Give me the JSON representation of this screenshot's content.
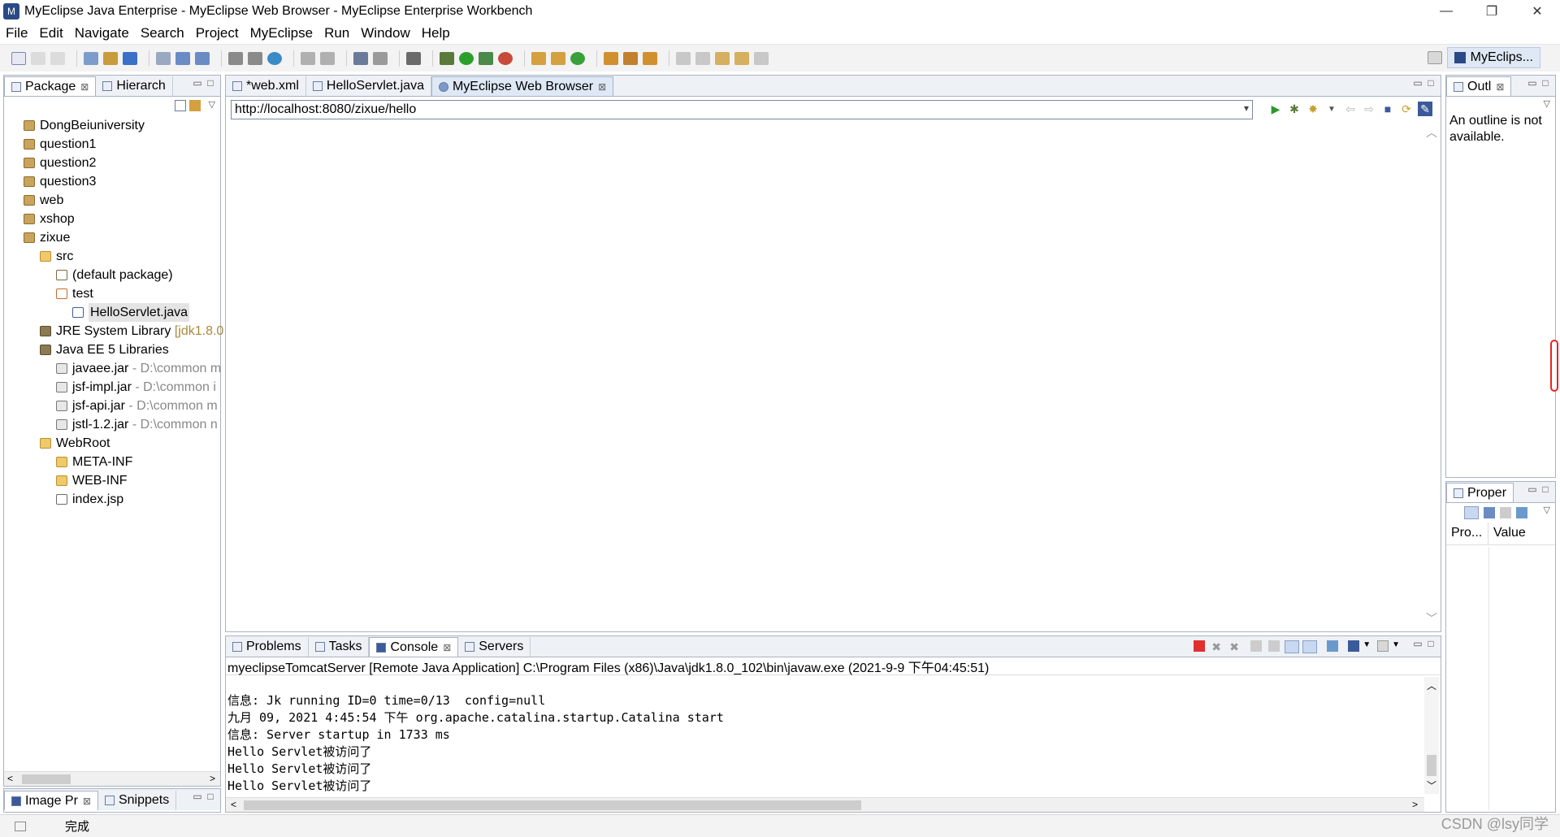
{
  "window": {
    "title": "MyEclipse Java Enterprise - MyEclipse Web Browser - MyEclipse Enterprise Workbench",
    "minimize": "—",
    "maximize": "❐",
    "close": "✕"
  },
  "menu": [
    "File",
    "Edit",
    "Navigate",
    "Search",
    "Project",
    "MyEclipse",
    "Run",
    "Window",
    "Help"
  ],
  "perspective": {
    "label": "MyEclips..."
  },
  "package_view": {
    "tabs": [
      {
        "label": "Package",
        "close": "⊠"
      },
      {
        "label": "Hierarch"
      }
    ],
    "tree": [
      {
        "label": "DongBeiuniversity"
      },
      {
        "label": "question1"
      },
      {
        "label": "question2"
      },
      {
        "label": "question3"
      },
      {
        "label": "web"
      },
      {
        "label": "xshop"
      },
      {
        "label": "zixue"
      },
      {
        "label": "src"
      },
      {
        "label": "(default package)"
      },
      {
        "label": "test"
      },
      {
        "label": "HelloServlet.java"
      },
      {
        "label": "JRE System Library",
        "suffix": "[jdk1.8.0"
      },
      {
        "label": "Java EE 5 Libraries"
      },
      {
        "label": "javaee.jar",
        "suffix": "- D:\\common m"
      },
      {
        "label": "jsf-impl.jar",
        "suffix": "- D:\\common i"
      },
      {
        "label": "jsf-api.jar",
        "suffix": "- D:\\common m"
      },
      {
        "label": "jstl-1.2.jar",
        "suffix": "- D:\\common n"
      },
      {
        "label": "WebRoot"
      },
      {
        "label": "META-INF"
      },
      {
        "label": "WEB-INF"
      },
      {
        "label": "index.jsp"
      }
    ]
  },
  "image_view": {
    "tabs": [
      {
        "label": "Image Pr",
        "close": "⊠"
      },
      {
        "label": "Snippets"
      }
    ]
  },
  "editor": {
    "tabs": [
      {
        "label": "*web.xml"
      },
      {
        "label": "HelloServlet.java"
      },
      {
        "label": "MyEclipse Web Browser",
        "close": "⊠"
      }
    ],
    "url": "http://localhost:8080/zixue/hello"
  },
  "console_view": {
    "tabs": [
      {
        "label": "Problems"
      },
      {
        "label": "Tasks"
      },
      {
        "label": "Console",
        "close": "⊠"
      },
      {
        "label": "Servers"
      }
    ],
    "info": "myeclipseTomcatServer [Remote Java Application] C:\\Program Files (x86)\\Java\\jdk1.8.0_102\\bin\\javaw.exe (2021-9-9 下午04:45:51)",
    "lines": [
      "信息: Jk running ID=0 time=0/13  config=null",
      "九月 09, 2021 4:45:54 下午 org.apache.catalina.startup.Catalina start",
      "信息: Server startup in 1733 ms",
      "Hello Servlet被访问了",
      "Hello Servlet被访问了",
      "Hello Servlet被访问了"
    ]
  },
  "outline_view": {
    "tab": "Outl",
    "message": "An outline is not available."
  },
  "properties_view": {
    "tab": "Proper",
    "columns": [
      "Pro...",
      "Value"
    ]
  },
  "status": {
    "text": "完成"
  },
  "watermark": "CSDN @lsy同学"
}
